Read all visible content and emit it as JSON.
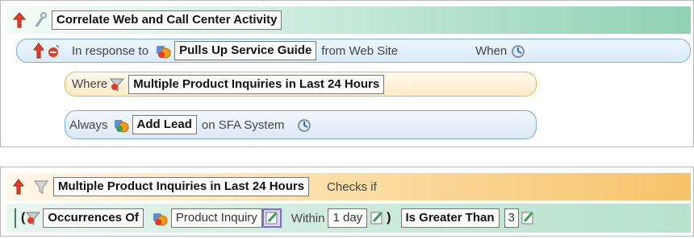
{
  "top_panel": {
    "title": "Correlate Web and Call Center Activity",
    "response_row": {
      "prefix": "In response to",
      "event": "Pulls Up Service Guide",
      "source": "from Web Site",
      "when_label": "When"
    },
    "where_row": {
      "prefix": "Where",
      "filter": "Multiple Product Inquiries in Last 24 Hours"
    },
    "always_row": {
      "prefix": "Always",
      "action": "Add Lead",
      "target": "on SFA System"
    }
  },
  "bottom_panel": {
    "title": "Multiple Product Inquiries in Last 24 Hours",
    "checks_label": "Checks if",
    "condition": {
      "open_paren": "(",
      "function": "Occurrences Of",
      "event": "Product Inquiry",
      "within_label": "Within",
      "duration": "1 day",
      "close_paren": ")",
      "operator": "Is Greater Than",
      "threshold": "3"
    }
  },
  "colors": {
    "teal_header": "#8fd1b3",
    "orange_header": "#f7c36a",
    "blue_pill_border": "#7ab0d9",
    "orange_pill_border": "#f2b44e"
  }
}
